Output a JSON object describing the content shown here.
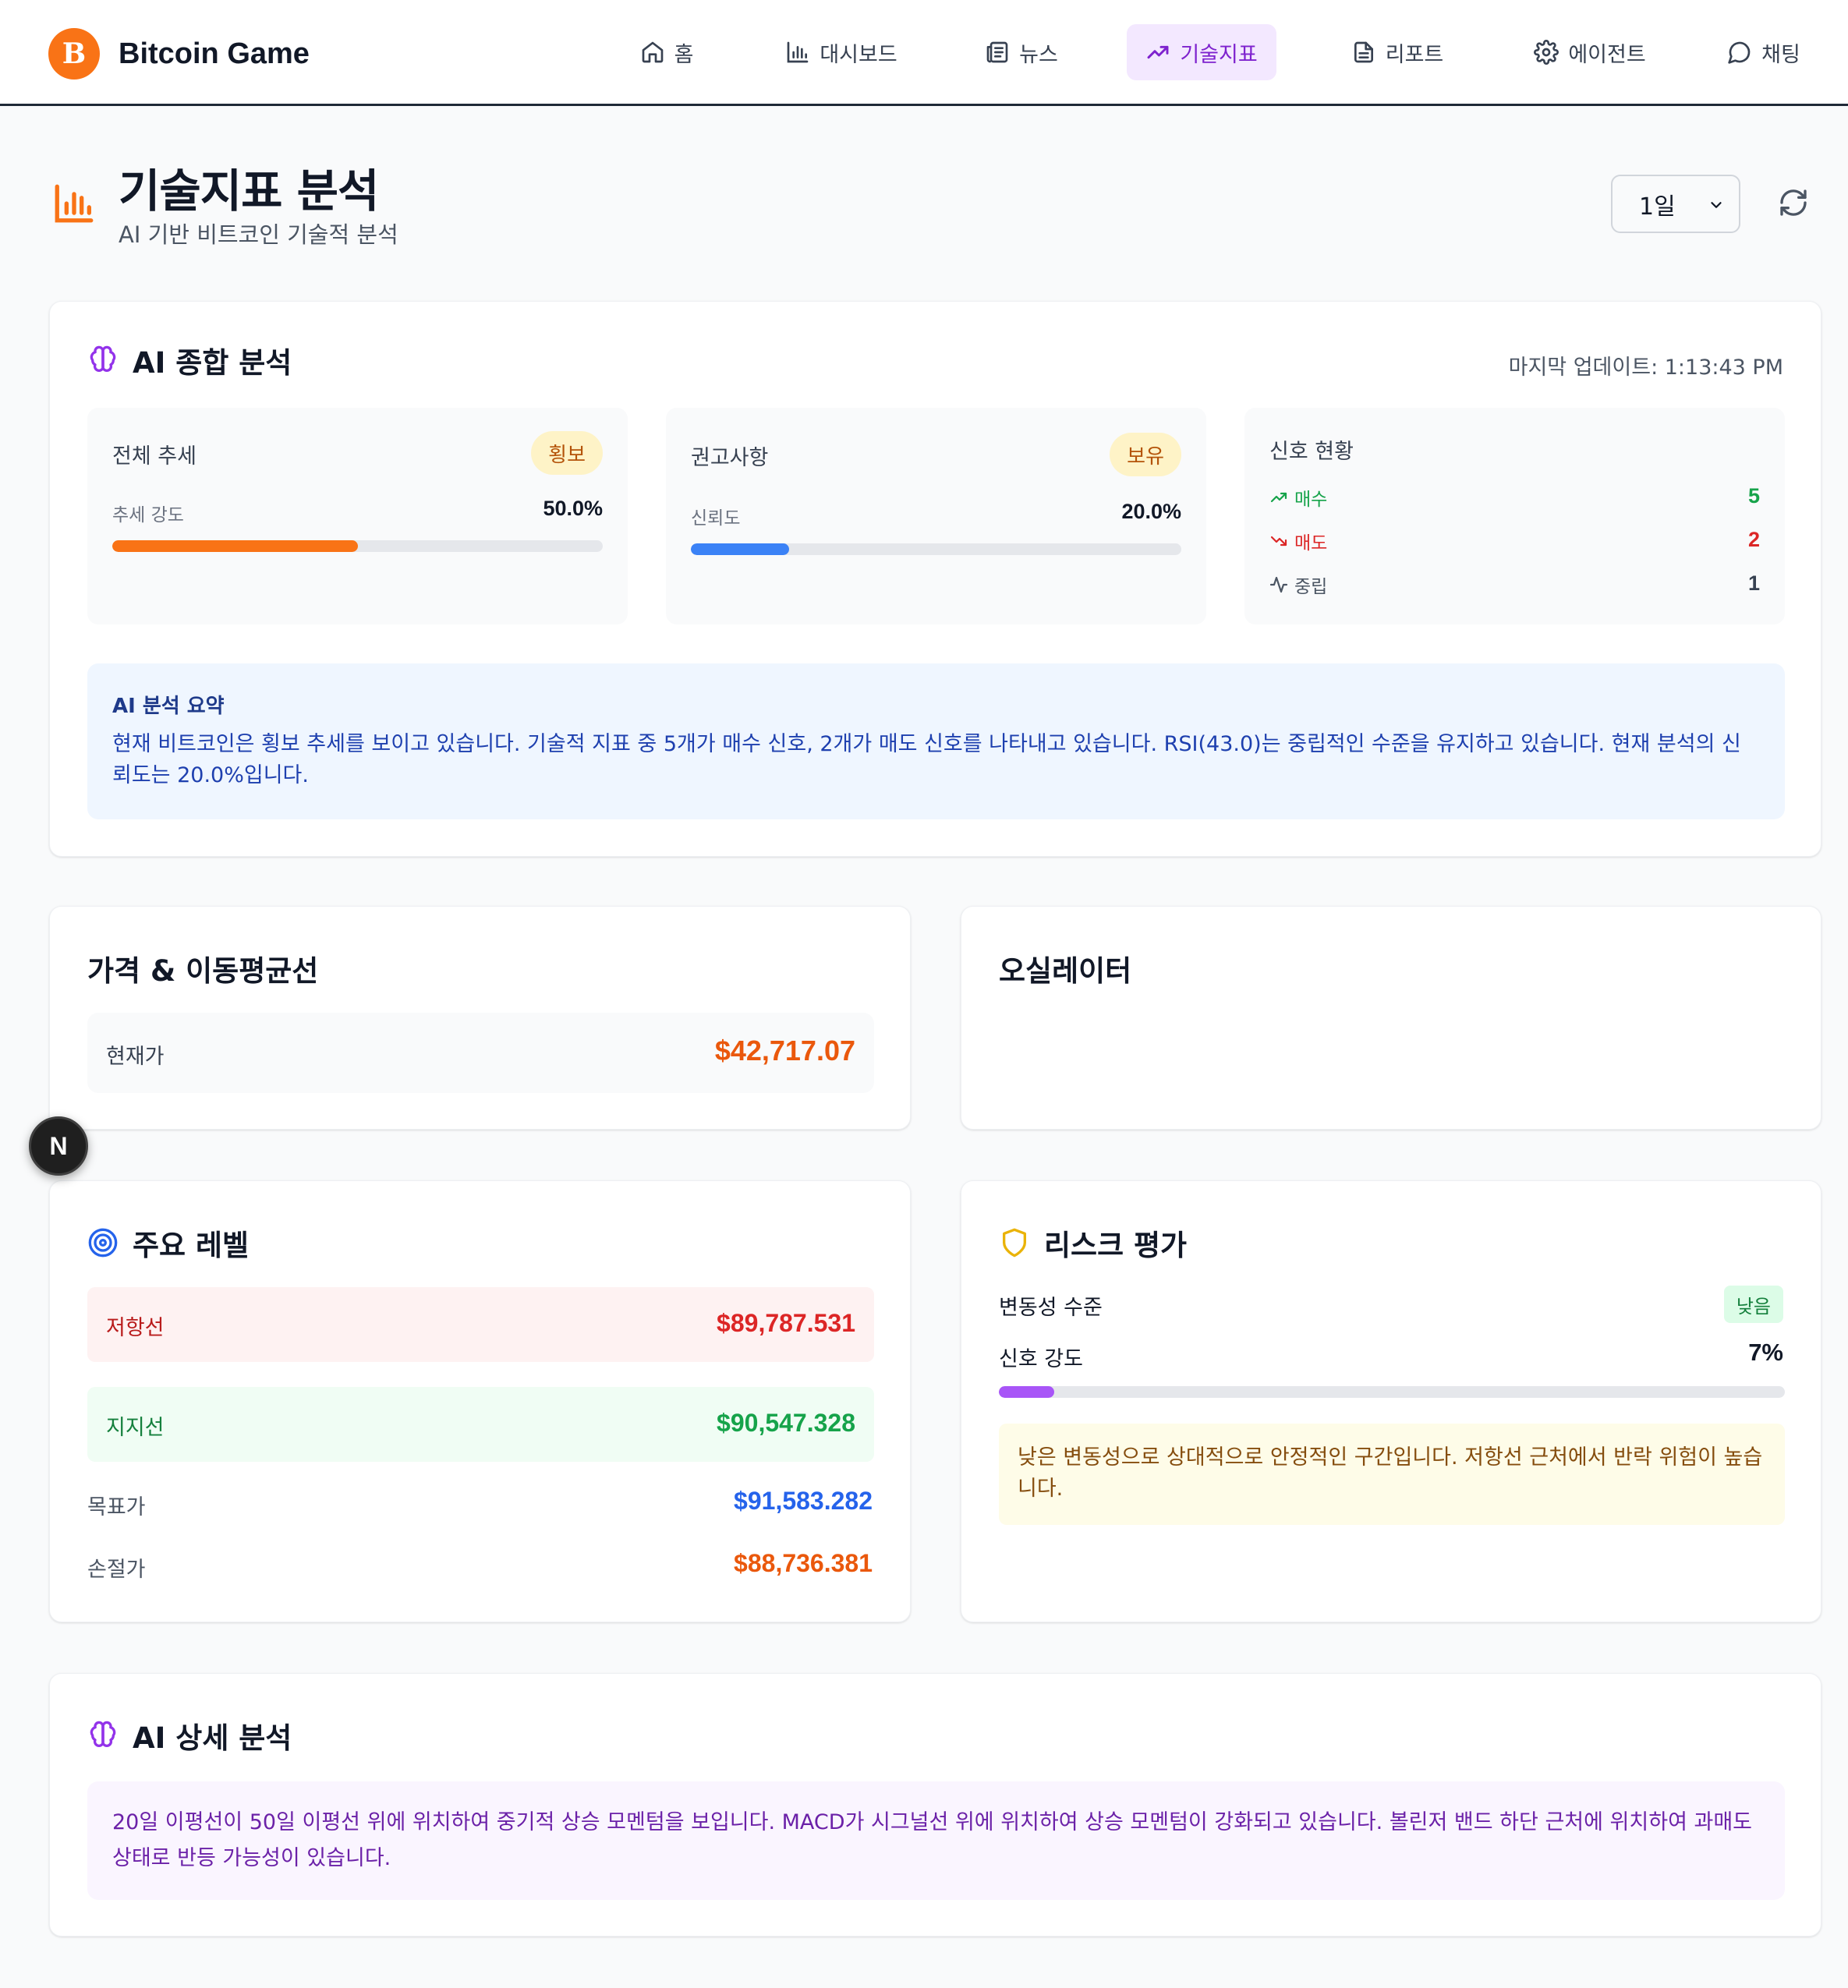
{
  "brand": {
    "logo_glyph": "B",
    "name": "Bitcoin Game"
  },
  "nav": [
    {
      "label": "홈",
      "icon": "home-icon"
    },
    {
      "label": "대시보드",
      "icon": "bar-chart-icon"
    },
    {
      "label": "뉴스",
      "icon": "newspaper-icon"
    },
    {
      "label": "기술지표",
      "icon": "trending-up-icon",
      "active": true
    },
    {
      "label": "리포트",
      "icon": "file-text-icon"
    },
    {
      "label": "에이전트",
      "icon": "gear-icon"
    },
    {
      "label": "채팅",
      "icon": "chat-bubble-icon"
    }
  ],
  "page": {
    "title": "기술지표 분석",
    "subtitle": "AI 기반 비트코인 기술적 분석",
    "period_value": "1일"
  },
  "ai_summary": {
    "title": "AI 종합 분석",
    "last_update": "마지막 업데이트: 1:13:43 PM",
    "trend": {
      "label": "전체 추세",
      "badge": "횡보",
      "strength_label": "추세 강도",
      "strength_value": "50.0%",
      "strength_fraction": 0.5
    },
    "recommendation": {
      "label": "권고사항",
      "badge": "보유",
      "confidence_label": "신뢰도",
      "confidence_value": "20.0%",
      "confidence_fraction": 0.2
    },
    "signals": {
      "label": "신호 현황",
      "buy_label": "매수",
      "buy_count": "5",
      "sell_label": "매도",
      "sell_count": "2",
      "neutral_label": "중립",
      "neutral_count": "1"
    },
    "summary_title": "AI 분석 요약",
    "summary_text": "현재 비트코인은 횡보 추세를 보이고 있습니다. 기술적 지표 중 5개가 매수 신호, 2개가 매도 신호를 나타내고 있습니다. RSI(43.0)는 중립적인 수준을 유지하고 있습니다. 현재 분석의 신뢰도는 20.0%입니다."
  },
  "price_ma": {
    "title": "가격 & 이동평균선",
    "current_label": "현재가",
    "current_value": "$42,717.07"
  },
  "oscillator": {
    "title": "오실레이터"
  },
  "levels": {
    "title": "주요 레벨",
    "resistance_label": "저항선",
    "resistance_value": "$89,787.531",
    "support_label": "지지선",
    "support_value": "$90,547.328",
    "target_label": "목표가",
    "target_value": "$91,583.282",
    "stoploss_label": "손절가",
    "stoploss_value": "$88,736.381"
  },
  "risk": {
    "title": "리스크 평가",
    "volatility_label": "변동성 수준",
    "volatility_badge": "낮음",
    "signal_strength_label": "신호 강도",
    "signal_strength_value": "7%",
    "signal_strength_fraction": 0.07,
    "note": "낮은 변동성으로 상대적으로 안정적인 구간입니다. 저항선 근처에서 반락 위험이 높습니다."
  },
  "ai_detail": {
    "title": "AI 상세 분석",
    "text": "20일 이평선이 50일 이평선 위에 위치하여 중기적 상승 모멘텀을 보입니다. MACD가 시그널선 위에 위치하여 상승 모멘텀이 강화되고 있습니다. 볼린저 밴드 하단 근처에 위치하여 과매도 상태로 반등 가능성이 있습니다."
  },
  "floating_button": {
    "glyph": "N"
  },
  "colors": {
    "accent_orange": "#f97316",
    "accent_purple": "#7e22ce",
    "buy_green": "#16a34a",
    "sell_red": "#dc2626",
    "info_blue": "#2563eb",
    "price_orange": "#ea580c"
  }
}
